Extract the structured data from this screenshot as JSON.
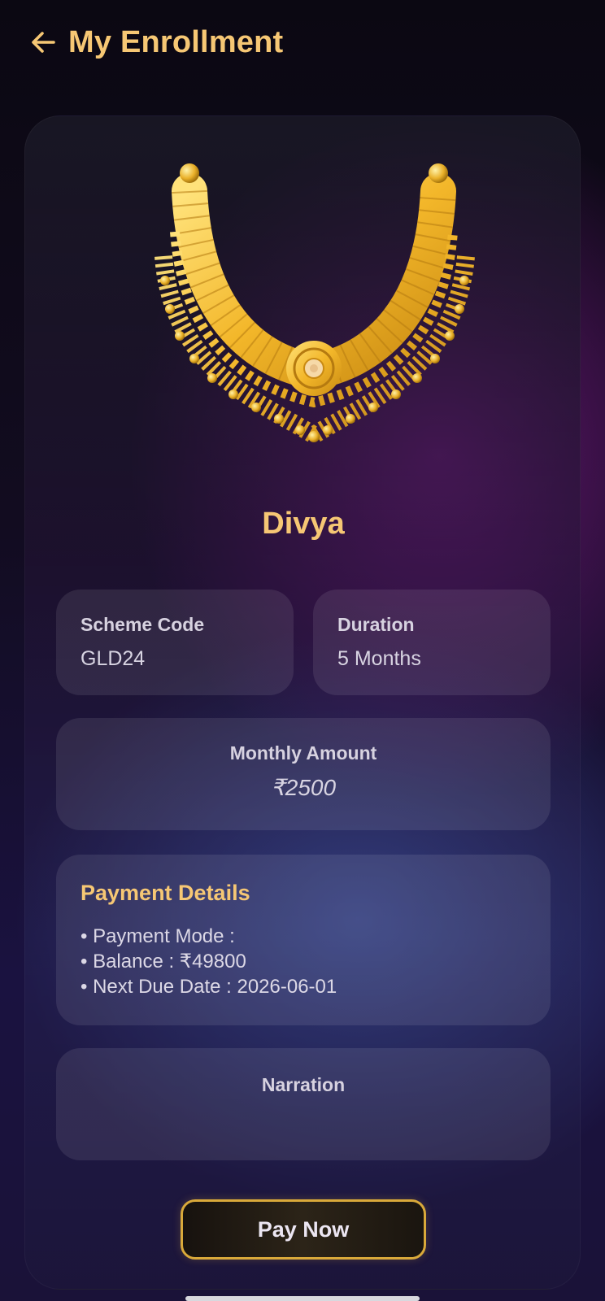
{
  "header": {
    "title": "My Enrollment",
    "back_icon": "arrow-left-icon"
  },
  "enrollment": {
    "name": "Divya",
    "scheme_code": {
      "label": "Scheme Code",
      "value": "GLD24"
    },
    "duration": {
      "label": "Duration",
      "value": "5 Months"
    },
    "monthly_amount": {
      "label": "Monthly Amount",
      "value": "₹2500"
    },
    "payment_details": {
      "title": "Payment Details",
      "lines": [
        "• Payment Mode :",
        "• Balance : ₹49800",
        "• Next Due Date : 2026-06-01"
      ]
    },
    "narration": {
      "label": "Narration",
      "value": ""
    }
  },
  "actions": {
    "pay_now_label": "Pay Now"
  },
  "colors": {
    "accent_gold": "#f6c774",
    "button_border": "#d9a93a",
    "background_dark": "#0b0812",
    "glow_purple": "#761882",
    "glow_blue": "#3c52a0"
  }
}
